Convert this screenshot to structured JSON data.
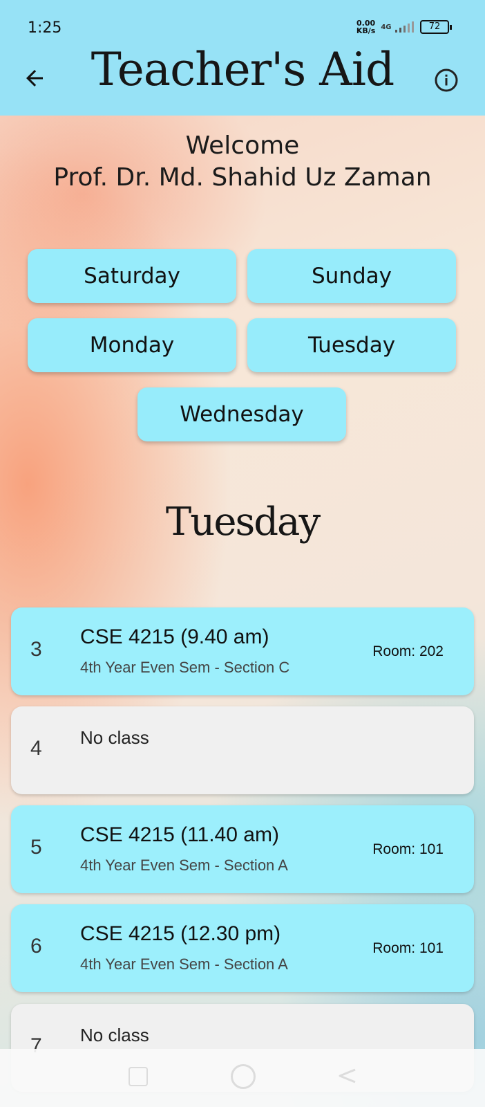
{
  "status_bar": {
    "time": "1:25",
    "net_speed_top": "0.00",
    "net_speed_bottom": "KB/s",
    "network": "4G",
    "battery": "72"
  },
  "appbar": {
    "title": "Teacher's Aid",
    "back_icon": "arrow-left-icon",
    "info_icon": "info-circle-icon",
    "background_color": "#97e2f6"
  },
  "welcome": {
    "greeting": "Welcome",
    "name": "Prof. Dr. Md. Shahid Uz Zaman"
  },
  "days": [
    "Saturday",
    "Sunday",
    "Monday",
    "Tuesday",
    "Wednesday"
  ],
  "selected_day": "Tuesday",
  "schedule": [
    {
      "period": "3",
      "course": "CSE 4215 (9.40 am)",
      "section": "4th Year Even Sem - Section C",
      "room": "Room: 202"
    },
    {
      "period": "4",
      "no_class": "No class"
    },
    {
      "period": "5",
      "course": "CSE 4215 (11.40 am)",
      "section": "4th Year Even Sem - Section A",
      "room": "Room: 101"
    },
    {
      "period": "6",
      "course": "CSE 4215 (12.30 pm)",
      "section": "4th Year Even Sem - Section A",
      "room": "Room: 101"
    },
    {
      "period": "7",
      "no_class": "No class"
    }
  ],
  "colors": {
    "class_card": "#9ceffc",
    "empty_card": "#f0f0f0",
    "day_button": "#97ecfb"
  }
}
